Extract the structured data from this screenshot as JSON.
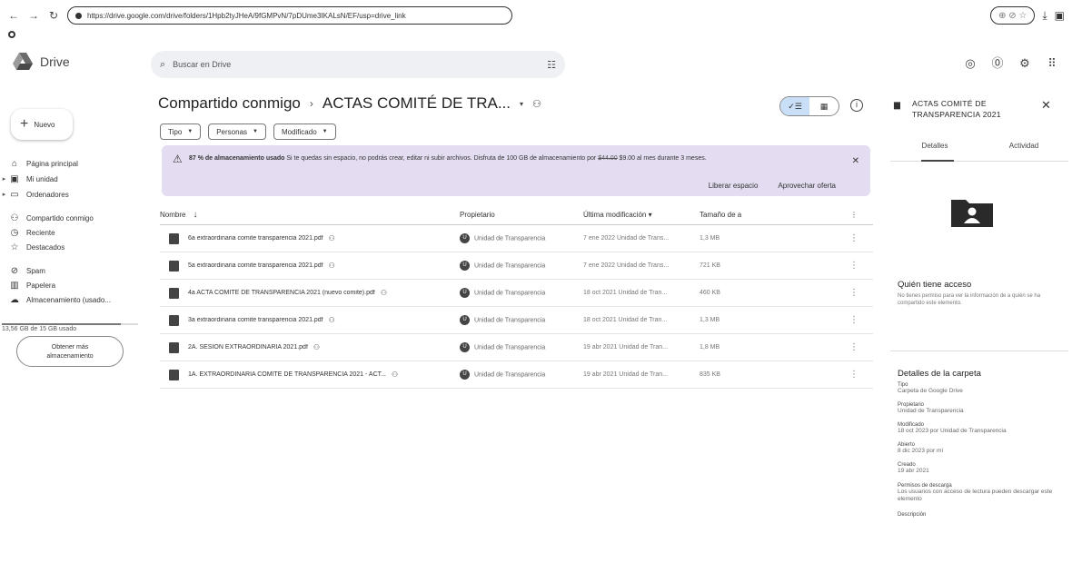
{
  "browser": {
    "url": "https://drive.google.com/drive/folders/1Hpb2tyJHeA/9fGMPvN/7pDUme3IKALsN/EF/usp=drive_link",
    "ext_icons": "⊕ ⊘ ☆"
  },
  "app": {
    "name": "Drive",
    "search_placeholder": "Buscar en Drive"
  },
  "sidebar": {
    "new_label": "Nuevo",
    "items": [
      {
        "label": "Página principal",
        "icon": "home-icon"
      },
      {
        "label": "Mi unidad",
        "icon": "my-drive-icon"
      },
      {
        "label": "Ordenadores",
        "icon": "computer-icon"
      },
      {
        "label": "Compartido conmigo",
        "icon": "people-icon"
      },
      {
        "label": "Reciente",
        "icon": "clock-icon"
      },
      {
        "label": "Destacados",
        "icon": "star-icon"
      },
      {
        "label": "Spam",
        "icon": "spam-icon"
      },
      {
        "label": "Papelera",
        "icon": "trash-icon"
      },
      {
        "label": "Almacenamiento (usado...",
        "icon": "cloud-icon"
      }
    ],
    "storage_text": "13,56 GB de 15 GB usado",
    "storage_fraction": 0.87,
    "more_storage_line1": "Obtener más",
    "more_storage_line2": "almacenamiento"
  },
  "main": {
    "breadcrumb_root": "Compartido conmigo",
    "breadcrumb_current": "ACTAS COMITÉ DE TRA...",
    "filters": [
      "Tipo",
      "Personas",
      "Modificado"
    ],
    "banner": {
      "bold": "87 % de almacenamiento usado",
      "text": " Si te quedas sin espacio, no podrás crear, editar ni subir archivos. Disfruta de 100 GB de almacenamiento por ",
      "old_price": "$44.00",
      "text2": " $9.00 al mes durante 3 meses.",
      "action1": "Liberar espacio",
      "action2": "Aprovechar oferta"
    },
    "columns": {
      "name": "Nombre",
      "owner": "Propietario",
      "modified": "Última modificación",
      "size": "Tamaño de a"
    },
    "files": [
      {
        "name": "6a extraordinaria comite transparencia 2021.pdf",
        "owner": "Unidad de Transparencia",
        "modified": "7 ene 2022 Unidad de Trans...",
        "size": "1,3 MB"
      },
      {
        "name": "5a extraordinaria comite transparencia 2021.pdf",
        "owner": "Unidad de Transparencia",
        "modified": "7 ene 2022 Unidad de Trans...",
        "size": "721 KB"
      },
      {
        "name": "4a ACTA COMITE DE TRANSPARENCIA 2021 (nuevo comite).pdf",
        "owner": "Unidad de Transparencia",
        "modified": "18 oct 2021 Unidad de Tran...",
        "size": "460 KB"
      },
      {
        "name": "3a extraordinaria comite transparencia 2021.pdf",
        "owner": "Unidad de Transparencia",
        "modified": "18 oct 2021 Unidad de Tran...",
        "size": "1,3 MB"
      },
      {
        "name": "2A. SESION EXTRAORDINARIA 2021.pdf",
        "owner": "Unidad de Transparencia",
        "modified": "19 abr 2021 Unidad de Tran...",
        "size": "1,8 MB"
      },
      {
        "name": "1A. EXTRAORDINARIA COMITE DE TRANSPARENCIA 2021 - ACT...",
        "owner": "Unidad de Transparencia",
        "modified": "19 abr 2021 Unidad de Tran...",
        "size": "835 KB"
      }
    ],
    "owner_avatar_letter": "U"
  },
  "details": {
    "title": "ACTAS COMITÉ DE TRANSPARENCIA 2021",
    "tab_details": "Detalles",
    "tab_activity": "Actividad",
    "access_title": "Quién tiene acceso",
    "access_text": "No tienes permiso para ver la información de a quién se ha compartido este elemento.",
    "folder_details_title": "Detalles de la carpeta",
    "props": [
      {
        "label": "Tipo",
        "value": "Carpeta de Google Drive"
      },
      {
        "label": "Propietario",
        "value": "Unidad de Transparencia"
      },
      {
        "label": "Modificado",
        "value": "18 oct 2023 por Unidad de Transparencia"
      },
      {
        "label": "Abierto",
        "value": "8 dic 2023 por mí"
      },
      {
        "label": "Creado",
        "value": "19 abr 2021"
      },
      {
        "label": "Permisos de descarga",
        "value": "Los usuarios con acceso de lectura pueden descargar este elemento"
      },
      {
        "label": "Descripción",
        "value": ""
      }
    ]
  }
}
